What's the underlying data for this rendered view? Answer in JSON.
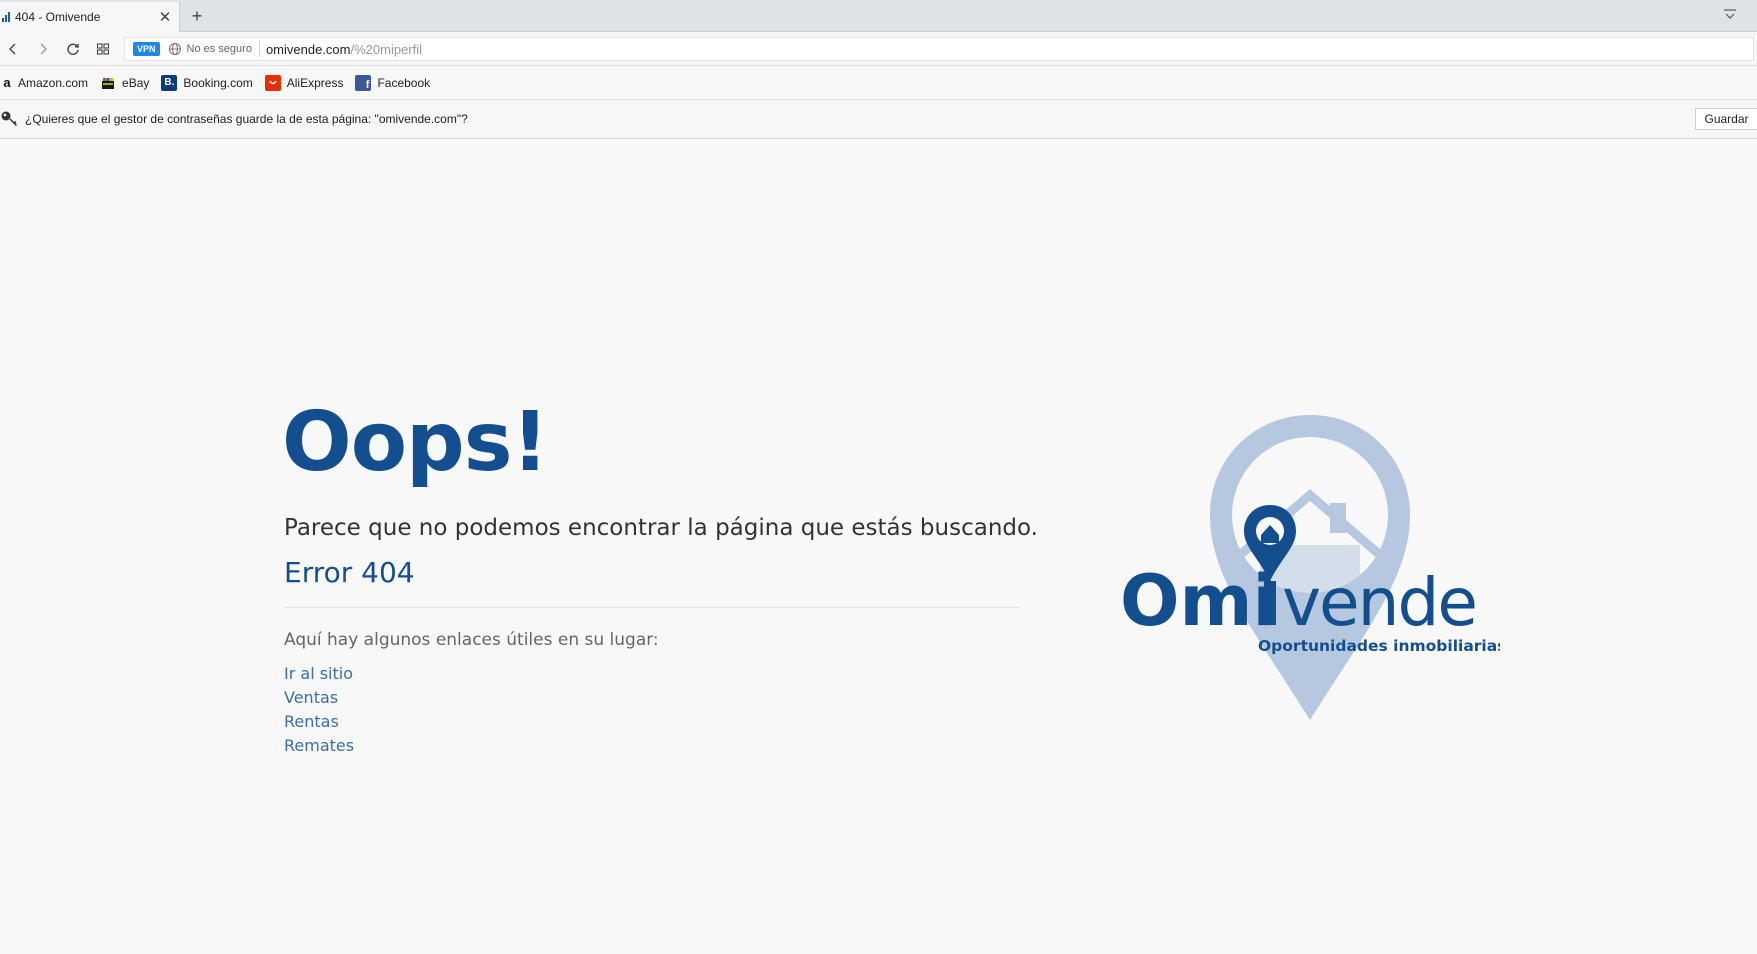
{
  "browser": {
    "tab_title": "404 - Omivende",
    "tab_close": "✕",
    "new_tab": "+",
    "vpn_label": "VPN",
    "security_label": "No es seguro",
    "url_host": "omivende.com",
    "url_path": "/%20miperfil"
  },
  "bookmarks": [
    {
      "label": "Amazon.com",
      "icon": "amazon-icon",
      "icon_text": "a",
      "color": "#ffffff"
    },
    {
      "label": "eBay",
      "icon": "ebay-icon",
      "icon_text": "",
      "color": "#ffffff"
    },
    {
      "label": "Booking.com",
      "icon": "booking-icon",
      "icon_text": "B.",
      "color": "#0c3b7c"
    },
    {
      "label": "AliExpress",
      "icon": "aliexpress-icon",
      "icon_text": "",
      "color": "#e62e04"
    },
    {
      "label": "Facebook",
      "icon": "facebook-icon",
      "icon_text": "f",
      "color": "#3b5998"
    }
  ],
  "password_bar": {
    "message": "¿Quieres que el gestor de contraseñas guarde la de esta página: \"omivende.com\"?",
    "save_label": "Guardar"
  },
  "page": {
    "heading": "Oops!",
    "subtitle": "Parece que no podemos encontrar la página que estás buscando.",
    "error_code": "Error 404",
    "links_intro": "Aquí hay algunos enlaces útiles en su lugar:",
    "links": [
      "Ir al sitio",
      "Ventas",
      "Rentas",
      "Remates"
    ]
  },
  "logo": {
    "brand_bold": "Omi",
    "brand_light": "vende",
    "tagline": "Oportunidades inmobiliarias",
    "primary_color": "#134f8f",
    "pin_color": "#b5c8df"
  }
}
